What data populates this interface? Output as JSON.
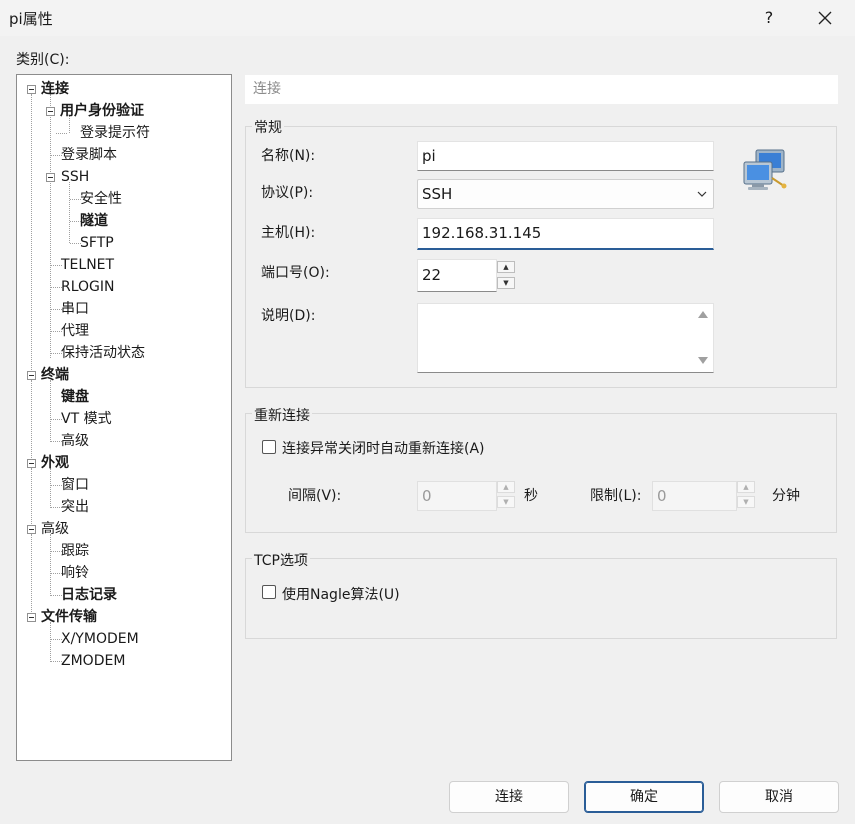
{
  "window": {
    "title": "pi属性",
    "help": "?"
  },
  "category_label": "类别(C):",
  "tree": [
    {
      "label": "连接",
      "bold": true
    },
    {
      "label": "用户身份验证",
      "bold": true
    },
    {
      "label": "登录提示符",
      "bold": false
    },
    {
      "label": "登录脚本",
      "bold": false
    },
    {
      "label": "SSH",
      "bold": false
    },
    {
      "label": "安全性",
      "bold": false
    },
    {
      "label": "隧道",
      "bold": true
    },
    {
      "label": "SFTP",
      "bold": false
    },
    {
      "label": "TELNET",
      "bold": false
    },
    {
      "label": "RLOGIN",
      "bold": false
    },
    {
      "label": "串口",
      "bold": false
    },
    {
      "label": "代理",
      "bold": false
    },
    {
      "label": "保持活动状态",
      "bold": false
    },
    {
      "label": "终端",
      "bold": true
    },
    {
      "label": "键盘",
      "bold": true
    },
    {
      "label": "VT 模式",
      "bold": false
    },
    {
      "label": "高级",
      "bold": false
    },
    {
      "label": "外观",
      "bold": true
    },
    {
      "label": "窗口",
      "bold": false
    },
    {
      "label": "突出",
      "bold": false
    },
    {
      "label": "高级",
      "bold": false
    },
    {
      "label": "跟踪",
      "bold": false
    },
    {
      "label": "响铃",
      "bold": false
    },
    {
      "label": "日志记录",
      "bold": true
    },
    {
      "label": "文件传输",
      "bold": true
    },
    {
      "label": "X/YMODEM",
      "bold": false
    },
    {
      "label": "ZMODEM",
      "bold": false
    }
  ],
  "panel": {
    "header": "连接",
    "general": {
      "title": "常规",
      "name_label": "名称(N):",
      "name_value": "pi",
      "protocol_label": "协议(P):",
      "protocol_value": "SSH",
      "host_label": "主机(H):",
      "host_value": "192.168.31.145",
      "port_label": "端口号(O):",
      "port_value": "22",
      "desc_label": "说明(D):",
      "desc_value": ""
    },
    "reconnect": {
      "title": "重新连接",
      "checkbox_label": "连接异常关闭时自动重新连接(A)",
      "interval_label": "间隔(V):",
      "interval_value": "0",
      "interval_unit": "秒",
      "limit_label": "限制(L):",
      "limit_value": "0",
      "limit_unit": "分钟"
    },
    "tcp": {
      "title": "TCP选项",
      "nagle_label": "使用Nagle算法(U)"
    }
  },
  "buttons": {
    "connect": "连接",
    "ok": "确定",
    "cancel": "取消"
  },
  "colors": {
    "accent": "#2a5d97",
    "background": "#f0f0f0"
  }
}
